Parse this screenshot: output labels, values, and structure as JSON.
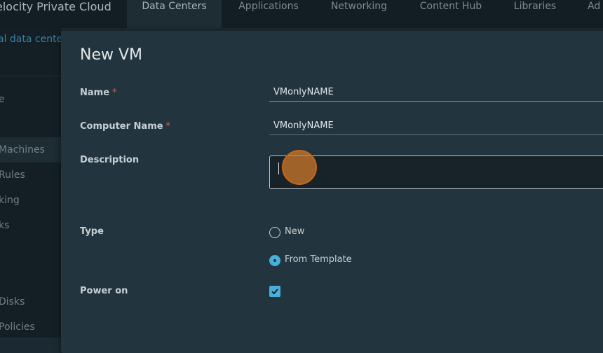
{
  "app": {
    "title": "elocity Private Cloud"
  },
  "nav": {
    "tabs": [
      {
        "label": "Data Centers",
        "active": true
      },
      {
        "label": "Applications"
      },
      {
        "label": "Networking"
      },
      {
        "label": "Content Hub"
      },
      {
        "label": "Libraries"
      },
      {
        "label": "Ad"
      }
    ]
  },
  "sidebar": {
    "breadcrumb": "al data cente",
    "items": [
      {
        "label": "e"
      },
      {
        "label": "Machines",
        "selected": true
      },
      {
        "label": "Rules"
      },
      {
        "label": "king"
      },
      {
        "label": "ks"
      },
      {
        "label": "Disks"
      },
      {
        "label": "Policies"
      }
    ]
  },
  "modal": {
    "title": "New VM",
    "name": {
      "label": "Name",
      "required_mark": "*",
      "value": "VMonlyNAME"
    },
    "computer_name": {
      "label": "Computer Name",
      "required_mark": "*",
      "value": "VMonlyNAME"
    },
    "description": {
      "label": "Description",
      "value": ""
    },
    "type": {
      "label": "Type",
      "options": [
        {
          "label": "New",
          "checked": false
        },
        {
          "label": "From Template",
          "checked": true
        }
      ]
    },
    "power_on": {
      "label": "Power on",
      "checked": true
    }
  },
  "colors": {
    "accent": "#49afd9",
    "required": "#e2574c",
    "cursor_highlight": "#d87d28"
  }
}
